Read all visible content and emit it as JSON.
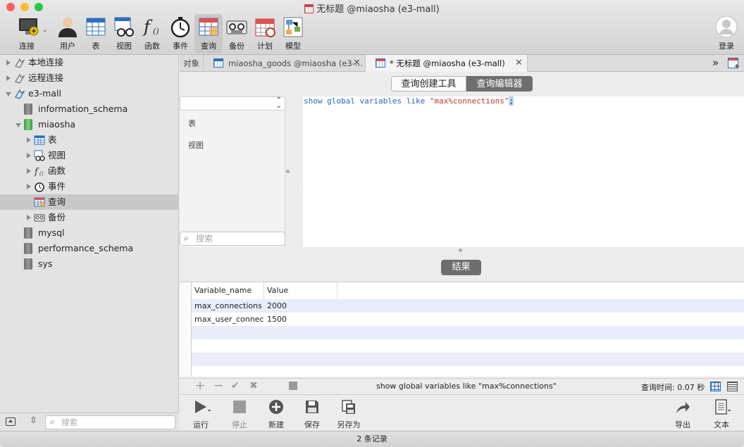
{
  "window": {
    "title": "无标题 @miaosha (e3-mall)",
    "traffic_colors": [
      "#fc5f57",
      "#fdbc2e",
      "#28c840"
    ]
  },
  "toolbar": {
    "connect": "连接",
    "user": "用户",
    "table": "表",
    "view": "视图",
    "function": "函数",
    "event": "事件",
    "query": "查询",
    "backup": "备份",
    "schedule": "计划",
    "model": "模型",
    "login": "登录"
  },
  "sidebar": {
    "items": [
      {
        "label": "本地连接"
      },
      {
        "label": "远程连接"
      },
      {
        "label": "e3-mall"
      },
      {
        "label": "information_schema"
      },
      {
        "label": "miaosha"
      },
      {
        "label": "表"
      },
      {
        "label": "视图"
      },
      {
        "label": "函数"
      },
      {
        "label": "事件"
      },
      {
        "label": "查询"
      },
      {
        "label": "备份"
      },
      {
        "label": "mysql"
      },
      {
        "label": "performance_schema"
      },
      {
        "label": "sys"
      }
    ],
    "search_placeholder": "搜索"
  },
  "tabs": {
    "objects": "对象",
    "tab1": "miaosha_goods @miaosha (e3-...",
    "tab2": "* 无标题 @miaosha (e3-mall)"
  },
  "segmented": {
    "builder": "查询创建工具",
    "editor": "查询编辑器"
  },
  "object_panel": {
    "table": "表",
    "view": "视图",
    "search_placeholder": "搜索"
  },
  "editor": {
    "kw1": "show",
    "kw2": "global",
    "kw3": "variables",
    "kw4": "like",
    "str": "\"max%connections\"",
    "semi": ";"
  },
  "results": {
    "button": "结果",
    "columns": [
      "Variable_name",
      "Value"
    ],
    "rows": [
      {
        "name": "max_connections",
        "value": "2000"
      },
      {
        "name": "max_user_connect",
        "value": "1500"
      }
    ]
  },
  "status": {
    "sql": "show global variables like \"max%connections\"",
    "time": "查询时间: 0.07 秒"
  },
  "actions": {
    "run": "运行",
    "stop": "停止",
    "new": "新建",
    "save": "保存",
    "save_as": "另存为",
    "export": "导出",
    "text": "文本"
  },
  "footer": {
    "records": "2 条记录"
  }
}
